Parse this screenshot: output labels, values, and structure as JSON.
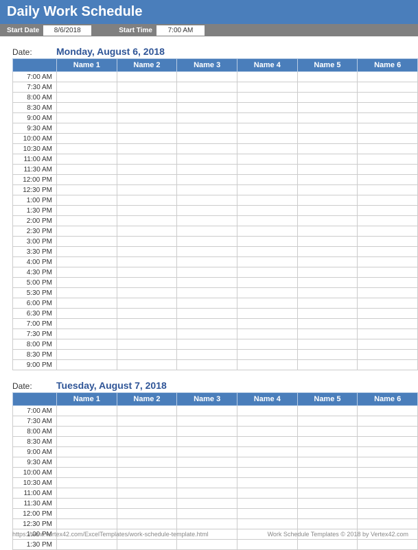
{
  "header": {
    "title": "Daily Work Schedule"
  },
  "params": {
    "start_date_label": "Start Date",
    "start_date_value": "8/6/2018",
    "start_time_label": "Start Time",
    "start_time_value": "7:00 AM"
  },
  "columns": [
    "Name 1",
    "Name 2",
    "Name 3",
    "Name 4",
    "Name 5",
    "Name 6"
  ],
  "days": [
    {
      "date_label": "Date:",
      "date_value": "Monday, August 6, 2018",
      "times": [
        "7:00 AM",
        "7:30 AM",
        "8:00 AM",
        "8:30 AM",
        "9:00 AM",
        "9:30 AM",
        "10:00 AM",
        "10:30 AM",
        "11:00 AM",
        "11:30 AM",
        "12:00 PM",
        "12:30 PM",
        "1:00 PM",
        "1:30 PM",
        "2:00 PM",
        "2:30 PM",
        "3:00 PM",
        "3:30 PM",
        "4:00 PM",
        "4:30 PM",
        "5:00 PM",
        "5:30 PM",
        "6:00 PM",
        "6:30 PM",
        "7:00 PM",
        "7:30 PM",
        "8:00 PM",
        "8:30 PM",
        "9:00 PM"
      ]
    },
    {
      "date_label": "Date:",
      "date_value": "Tuesday, August 7, 2018",
      "times": [
        "7:00 AM",
        "7:30 AM",
        "8:00 AM",
        "8:30 AM",
        "9:00 AM",
        "9:30 AM",
        "10:00 AM",
        "10:30 AM",
        "11:00 AM",
        "11:30 AM",
        "12:00 PM",
        "12:30 PM",
        "1:00 PM",
        "1:30 PM"
      ]
    }
  ],
  "footer": {
    "left": "https://www.vertex42.com/ExcelTemplates/work-schedule-template.html",
    "right": "Work Schedule Templates © 2018 by Vertex42.com"
  }
}
